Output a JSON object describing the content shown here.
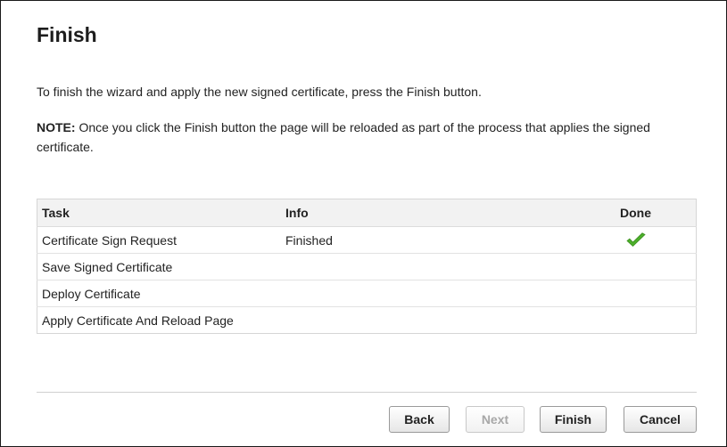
{
  "wizard": {
    "title": "Finish",
    "intro": "To finish the wizard and apply the new signed certificate, press the Finish button.",
    "note_label": "NOTE:",
    "note_text": " Once you click the Finish button the page will be reloaded as part of the process that applies the signed certificate."
  },
  "task_table": {
    "headers": {
      "task": "Task",
      "info": "Info",
      "done": "Done"
    },
    "rows": [
      {
        "task": "Certificate Sign Request",
        "info": "Finished",
        "done": true,
        "done_icon": "checkmark-icon"
      },
      {
        "task": "Save Signed Certificate",
        "info": "",
        "done": false
      },
      {
        "task": "Deploy Certificate",
        "info": "",
        "done": false
      },
      {
        "task": "Apply Certificate And Reload Page",
        "info": "",
        "done": false
      }
    ]
  },
  "buttons": {
    "back": "Back",
    "next": "Next",
    "finish": "Finish",
    "cancel": "Cancel",
    "next_disabled": true
  },
  "colors": {
    "check_green": "#4caf2a"
  }
}
